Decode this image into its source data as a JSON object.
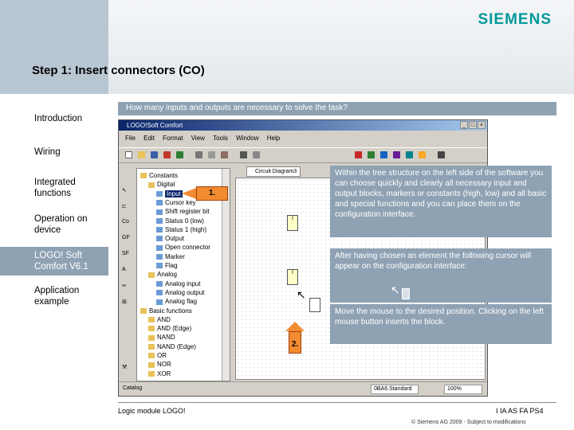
{
  "brand": "SIEMENS",
  "title": "Step 1: Insert connectors (CO)",
  "nav": [
    {
      "label": "Introduction"
    },
    {
      "label": "Wiring"
    },
    {
      "label": "Integrated functions"
    },
    {
      "label": "Operation on device"
    },
    {
      "label": "LOGO! Soft Comfort V6.1"
    },
    {
      "label": "Application example"
    }
  ],
  "question": "How many inputs and outputs are necessary to solve the task?",
  "app": {
    "title": "LOGO!Soft Comfort",
    "menu": [
      "File",
      "Edit",
      "Format",
      "View",
      "Tools",
      "Window",
      "Help"
    ],
    "tab": "Circuit Diagram3",
    "tree": [
      {
        "label": "Constants",
        "level": 0
      },
      {
        "label": "Digital",
        "level": 1
      },
      {
        "label": "Input",
        "level": 2
      },
      {
        "label": "Cursor key",
        "level": 2
      },
      {
        "label": "Shift register bit",
        "level": 2
      },
      {
        "label": "Status 0 (low)",
        "level": 2
      },
      {
        "label": "Status 1 (high)",
        "level": 2
      },
      {
        "label": "Output",
        "level": 2
      },
      {
        "label": "Open connector",
        "level": 2
      },
      {
        "label": "Marker",
        "level": 2
      },
      {
        "label": "Flag",
        "level": 2
      },
      {
        "label": "Analog",
        "level": 1
      },
      {
        "label": "Analog input",
        "level": 2
      },
      {
        "label": "Analog output",
        "level": 2
      },
      {
        "label": "Analog flag",
        "level": 2
      },
      {
        "label": "Basic functions",
        "level": 0
      },
      {
        "label": "AND",
        "level": 1
      },
      {
        "label": "AND (Edge)",
        "level": 1
      },
      {
        "label": "NAND",
        "level": 1
      },
      {
        "label": "NAND (Edge)",
        "level": 1
      },
      {
        "label": "OR",
        "level": 1
      },
      {
        "label": "NOR",
        "level": 1
      },
      {
        "label": "XOR",
        "level": 1
      }
    ],
    "block_label": "I",
    "status": {
      "catalog": "Catalog",
      "module": "0BA6.Standard",
      "zoom": "100%"
    }
  },
  "callouts": {
    "c1": "Within the tree structure on the left side of the software you can choose quickly and clearly all necessary input and output blocks, markers or constants (high, low) and all basic and special functions and you can place them on the configuration interface.",
    "c2": "After having chosen an element the following cursor will appear on the configuration interface:",
    "c3": "Move the mouse to the desired position. Clicking on the left mouse button inserts the block."
  },
  "markers": {
    "m1": "1.",
    "m2": "2."
  },
  "footer": {
    "left": "Logic module LOGO!",
    "right": "I IA AS FA PS4",
    "copyright": "© Siemens AG 2009 - Subject to modifications"
  },
  "colors": {
    "brand": "#009999",
    "accent": "#8fa2b4",
    "marker": "#f28b32"
  }
}
